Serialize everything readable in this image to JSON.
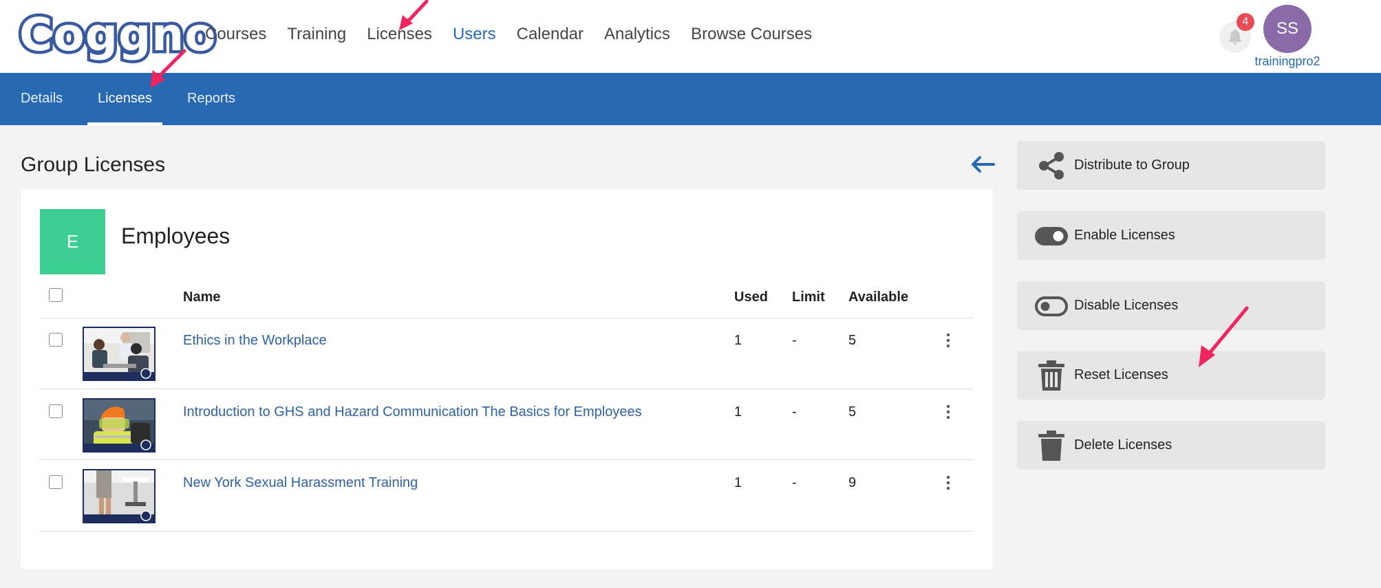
{
  "brand": {
    "logo_text": "Coggno"
  },
  "topnav": [
    "Courses",
    "Training",
    "Licenses",
    "Users",
    "Calendar",
    "Analytics",
    "Browse Courses"
  ],
  "notifications": {
    "count": "4"
  },
  "user": {
    "initials": "SS",
    "name": "trainingpro2"
  },
  "subnav": [
    "Details",
    "Licenses",
    "Reports"
  ],
  "page": {
    "title": "Group Licenses"
  },
  "group": {
    "initial": "E",
    "name": "Employees"
  },
  "table": {
    "headers": {
      "name": "Name",
      "used": "Used",
      "limit": "Limit",
      "available": "Available"
    },
    "rows": [
      {
        "name": "Ethics in the Workplace",
        "used": "1",
        "limit": "-",
        "available": "5"
      },
      {
        "name": "Introduction to GHS and Hazard Communication The Basics for Employees",
        "used": "1",
        "limit": "-",
        "available": "5"
      },
      {
        "name": "New York Sexual Harassment Training",
        "used": "1",
        "limit": "-",
        "available": "9"
      }
    ]
  },
  "actions": [
    {
      "label": "Distribute to Group",
      "icon": "share-icon"
    },
    {
      "label": "Enable Licenses",
      "icon": "toggle-on-icon"
    },
    {
      "label": "Disable Licenses",
      "icon": "toggle-off-icon"
    },
    {
      "label": "Reset Licenses",
      "icon": "trash-outline-icon"
    },
    {
      "label": "Delete Licenses",
      "icon": "trash-icon"
    }
  ],
  "colors": {
    "primary": "#2869b3",
    "group_badge": "#3ccf91",
    "avatar": "#8a6ba8",
    "badge": "#e84a56",
    "annotation": "#f0245f"
  }
}
